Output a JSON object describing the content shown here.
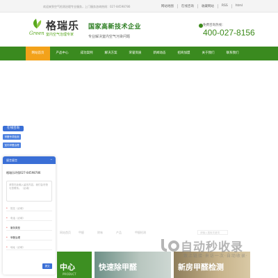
{
  "topbar": {
    "welcome": "欢迎来到空气检测治理专业服务，上门服务咨询热线：027-84598786",
    "links": [
      "网站地图",
      "在线咨询",
      "收藏网站",
      "RSS",
      "html"
    ]
  },
  "header": {
    "logo_name": "格瑞乐",
    "logo_green": "Green",
    "logo_sub": "室内空气治理专家",
    "slogan_title": "国家高新技术企业",
    "slogan_sub": "专业解决室内空气污染问题",
    "hotline_label": "免费咨询热线：",
    "hotline_number": "400-027-8156"
  },
  "nav": {
    "items": [
      "网站首页",
      "产品中心",
      "成功案例",
      "解决方案",
      "荣誉资质",
      "新闻动态",
      "招商加盟",
      "关于我们",
      "联系我们"
    ],
    "active_index": 0
  },
  "side": {
    "online_tab": "在线咨询",
    "links": [
      "甲醛专项检测",
      "室内甲醛治理"
    ]
  },
  "chat": {
    "title": "留言留言",
    "greet": "格瑞乐环保027-84598786",
    "message_placeholder": "请您在此输入留言内容，我们会尽快与您联系。（必填）",
    "fields": [
      {
        "label": "姓名（必填）",
        "required": true,
        "selected": false
      },
      {
        "label": "电话（必填）",
        "required": true,
        "selected": false
      },
      {
        "label": "服务类型",
        "required": true,
        "selected": true
      },
      {
        "label": "甲醛治理",
        "required": true,
        "selected": true
      },
      {
        "label": "地址（必填）",
        "required": true,
        "selected": false
      }
    ],
    "submit": "提交"
  },
  "faint_links": [
    "网站首页",
    "甲醛",
    "除味",
    "产品",
    "甲醛检测"
  ],
  "search_placeholder": "请输入搜索关键词",
  "cards": [
    {
      "title": "中心",
      "en": "PRODUCT"
    },
    {
      "title": "快速除甲醛"
    },
    {
      "title": "新房甲醛检测"
    }
  ],
  "watermark": {
    "text": "自动秒收录",
    "sub": "致上链接·来访一次·自动收录·"
  },
  "colors": {
    "nav_green": "#3a8a1f",
    "active_orange": "#f3a21a",
    "chat_blue": "#3a6fd6"
  }
}
